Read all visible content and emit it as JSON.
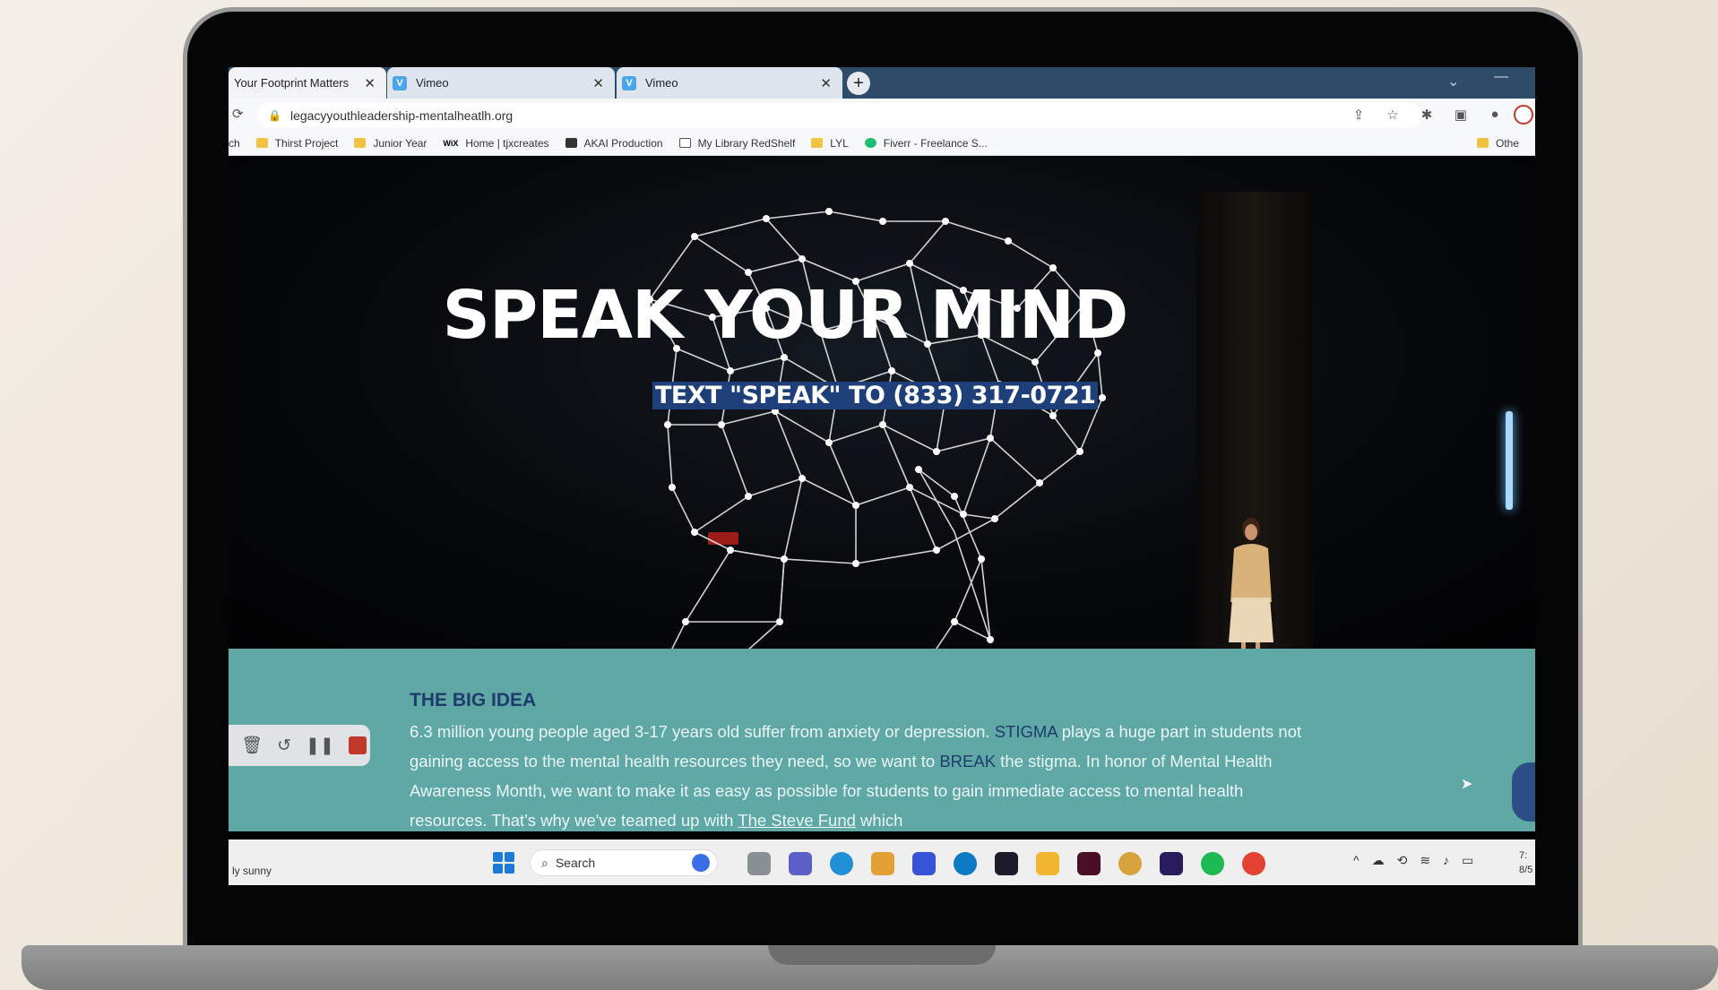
{
  "browser": {
    "tabs": [
      {
        "label": "Your Footprint Matters",
        "favicon": ""
      },
      {
        "label": "Vimeo",
        "favicon": "V"
      },
      {
        "label": "Vimeo",
        "favicon": "V"
      }
    ],
    "url": "legacyyouthleadership-mentalheatlh.org",
    "bookmarks": [
      {
        "label": "ch",
        "icon": "folder-icon"
      },
      {
        "label": "Thirst Project",
        "icon": "folder-icon"
      },
      {
        "label": "Junior Year",
        "icon": "folder-icon"
      },
      {
        "label": "Home | tjxcreates",
        "icon": "wix-icon",
        "icon_text": "WiX"
      },
      {
        "label": "AKAI Production",
        "icon": "akai-icon"
      },
      {
        "label": "My Library RedShelf",
        "icon": "document-icon"
      },
      {
        "label": "LYL",
        "icon": "folder-icon"
      },
      {
        "label": "Fiverr - Freelance S...",
        "icon": "fiverr-icon"
      }
    ],
    "other_bookmarks": "Othe"
  },
  "hero": {
    "title": "SPEAK YOUR MIND",
    "subtitle": "TEXT \"SPEAK\" TO (833) 317-0721"
  },
  "idea": {
    "title": "THE BIG IDEA",
    "text_1": "6.3 million young people aged 3-17 years old suffer from anxiety or depression. ",
    "stigma": "STIGMA",
    "text_2": " plays a huge part in students not gaining access to the mental health resources they need, so we want to ",
    "break": "BREAK",
    "text_3": " the stigma. In honor of Mental Health Awareness Month, we want to make it as easy as possible for students to gain immediate access to mental health resources. That's why we've teamed up with ",
    "link": "The Steve Fund",
    "text_4": " which"
  },
  "taskbar": {
    "weather": "ly sunny",
    "search_label": "Search",
    "clock_time": "7:",
    "clock_date": "8/5"
  },
  "colors": {
    "teal": "#5fa8a6",
    "navy": "#1d3c6c",
    "highlight": "#1f3f7a"
  }
}
